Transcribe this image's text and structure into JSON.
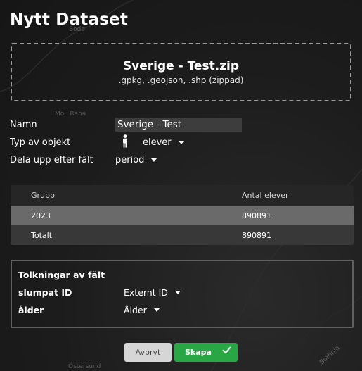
{
  "dialog": {
    "title": "Nytt Dataset"
  },
  "upload": {
    "file_name": "Sverige - Test.zip",
    "hint": ".gpkg, .geojson, .shp (zippad)"
  },
  "form": {
    "name_label": "Namn",
    "name_value": "Sverige - Test",
    "object_type_label": "Typ av objekt",
    "object_type_icon": "person-icon",
    "object_type_value": "elever",
    "split_label": "Dela upp efter fält",
    "split_value": "period"
  },
  "table": {
    "columns": [
      "Grupp",
      "Antal elever"
    ],
    "rows": [
      [
        "2023",
        "890891"
      ],
      [
        "Totalt",
        "890891"
      ]
    ]
  },
  "interpretations": {
    "title": "Tolkningar av fält",
    "fields": [
      {
        "label": "slumpat ID",
        "value": "Externt ID"
      },
      {
        "label": "ålder",
        "value": "Ålder"
      }
    ]
  },
  "actions": {
    "cancel_label": "Avbryt",
    "save_label": "Skapa",
    "save_icon": "check-icon"
  },
  "map_labels": {
    "bodo": "Bodø",
    "mo_i_rana": "Mo i Rana",
    "bothnia": "Bothnia",
    "ostersund": "Östersund"
  },
  "colors": {
    "background": "#1c1c1c",
    "accent_green": "#2aa745",
    "selected_row": "#6a6a6a",
    "input_bg": "#3d3d3d"
  }
}
